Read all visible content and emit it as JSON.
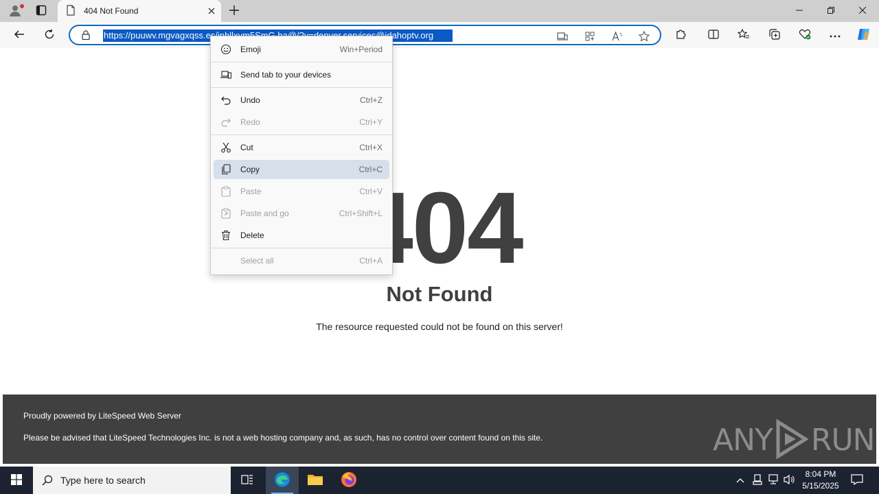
{
  "browser": {
    "tab_title": "404 Not Found",
    "url": "https://puuwv.mgvagxqss.es/jnbllxym5SmG.ha@/?y=denver.services@idahoptv.org"
  },
  "page": {
    "code": "404",
    "heading": "Not Found",
    "message": "The resource requested could not be found on this server!",
    "footer_line1": "Proudly powered by LiteSpeed Web Server",
    "footer_line2": "Please be advised that LiteSpeed Technologies Inc. is not a web hosting company and, as such, has no control over content found on this site.",
    "watermark_left": "ANY",
    "watermark_right": "RUN"
  },
  "context_menu": {
    "items": [
      {
        "label": "Emoji",
        "shortcut": "Win+Period",
        "icon": "emoji-icon",
        "enabled": true
      },
      {
        "label": "Send tab to your devices",
        "shortcut": "",
        "icon": "devices-icon",
        "enabled": true
      },
      {
        "label": "Undo",
        "shortcut": "Ctrl+Z",
        "icon": "undo-icon",
        "enabled": true
      },
      {
        "label": "Redo",
        "shortcut": "Ctrl+Y",
        "icon": "redo-icon",
        "enabled": false
      },
      {
        "label": "Cut",
        "shortcut": "Ctrl+X",
        "icon": "scissors-icon",
        "enabled": true
      },
      {
        "label": "Copy",
        "shortcut": "Ctrl+C",
        "icon": "copy-icon",
        "enabled": true,
        "highlighted": true
      },
      {
        "label": "Paste",
        "shortcut": "Ctrl+V",
        "icon": "paste-icon",
        "enabled": false
      },
      {
        "label": "Paste and go",
        "shortcut": "Ctrl+Shift+L",
        "icon": "paste-go-icon",
        "enabled": false
      },
      {
        "label": "Delete",
        "shortcut": "",
        "icon": "trash-icon",
        "enabled": true
      },
      {
        "label": "Select all",
        "shortcut": "Ctrl+A",
        "icon": "",
        "enabled": false
      }
    ]
  },
  "taskbar": {
    "search_placeholder": "Type here to search",
    "time": "8:04 PM",
    "date": "5/15/2025"
  },
  "colors": {
    "accent": "#0f6cbd",
    "selection": "#0a59c4",
    "footer_bg": "#404040",
    "taskbar_bg": "#1b2331",
    "menu_highlight": "#d6dfea"
  }
}
